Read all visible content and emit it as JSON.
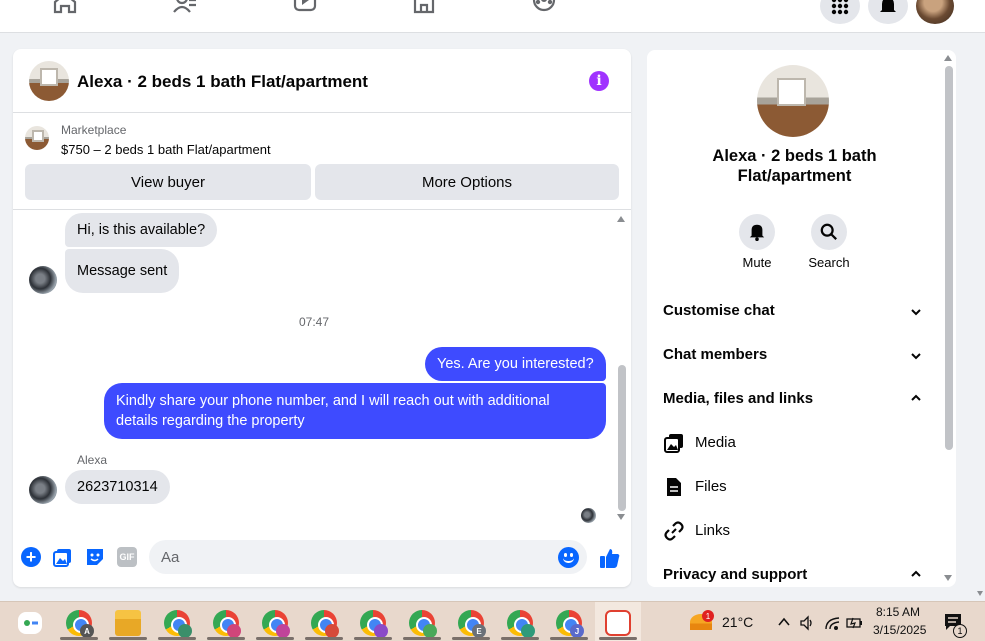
{
  "chat": {
    "title": "Alexa · 2 beds 1 bath Flat/apartment",
    "info_icon_glyph": "i",
    "marketplace_label": "Marketplace",
    "listing_price": "$750 – 2 beds 1 bath Flat/apartment",
    "view_buyer_label": "View buyer",
    "more_options_label": "More Options",
    "messages": [
      {
        "from": "them",
        "text": "Hi, is this available?"
      },
      {
        "from": "them",
        "text": "Message sent"
      },
      {
        "from": "me",
        "text": "Yes. Are you interested?"
      },
      {
        "from": "me",
        "text": "Kindly share your phone number, and I will reach out with additional details regarding the property"
      },
      {
        "from": "them",
        "text": "2623710314"
      }
    ],
    "timestamp": "07:47",
    "sender_name": "Alexa",
    "composer_placeholder": "Aa",
    "accent_color": "#3e4bff"
  },
  "details": {
    "title": "Alexa · 2 beds 1 bath Flat/apartment",
    "mute_label": "Mute",
    "search_label": "Search",
    "sections": [
      {
        "label": "Customise chat",
        "expanded": false
      },
      {
        "label": "Chat members",
        "expanded": false
      },
      {
        "label": "Media, files and links",
        "expanded": true
      },
      {
        "label": "Privacy and support",
        "expanded": true
      }
    ],
    "media_items": [
      {
        "label": "Media",
        "icon": "image-icon"
      },
      {
        "label": "Files",
        "icon": "file-icon"
      },
      {
        "label": "Links",
        "icon": "link-icon"
      }
    ]
  },
  "taskbar": {
    "weather_badge": "1",
    "temperature": "21°C",
    "time": "8:15 AM",
    "date": "3/15/2025",
    "notification_count": "1",
    "app_badges": [
      "A",
      "",
      "",
      "",
      "",
      "",
      "",
      "E",
      "",
      "J"
    ]
  }
}
